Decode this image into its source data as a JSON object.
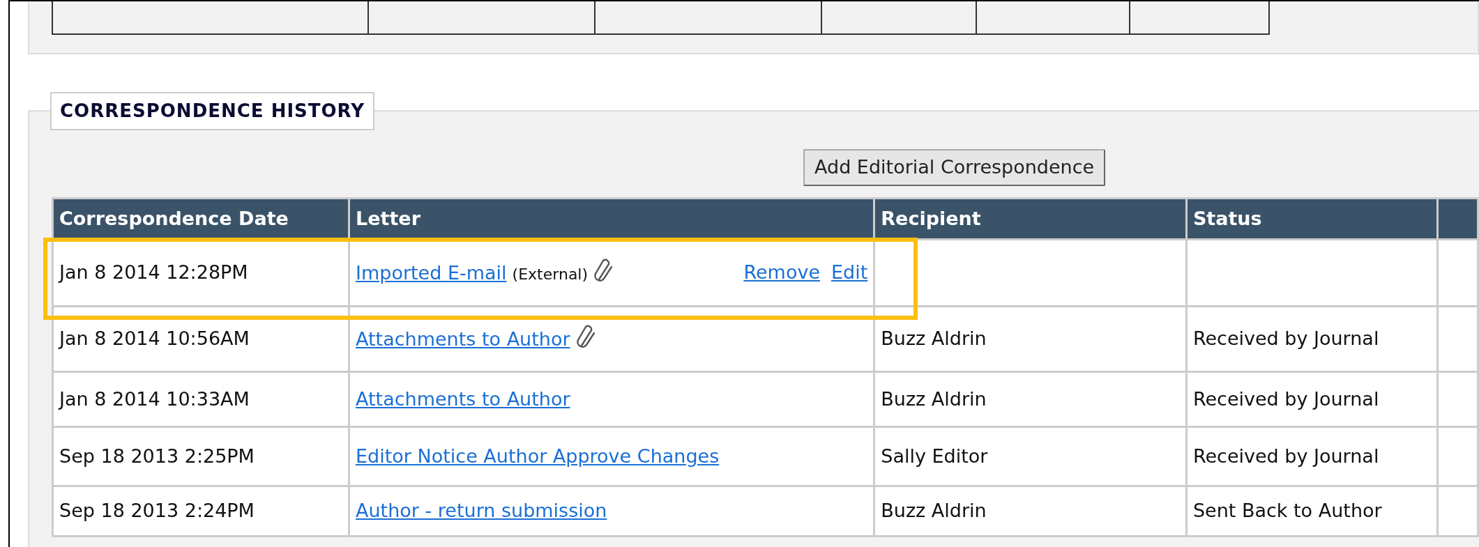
{
  "section": {
    "title": "CORRESPONDENCE HISTORY"
  },
  "add_button": {
    "label": "Add Editorial Correspondence"
  },
  "table": {
    "columns": [
      "Correspondence Date",
      "Letter",
      "Recipient",
      "Status"
    ],
    "rows": [
      {
        "date": "Jan 8 2014 12:28PM",
        "letter": "Imported E-mail",
        "note": "(External)",
        "attachment": true,
        "actions": [
          "Remove",
          "Edit"
        ],
        "recipient": "",
        "status": "",
        "highlighted": true
      },
      {
        "date": "Jan 8 2014 10:56AM",
        "letter": "Attachments to Author",
        "attachment": true,
        "recipient": "Buzz Aldrin",
        "status": "Received by Journal",
        "highlighted": false
      },
      {
        "date": "Jan 8 2014 10:33AM",
        "letter": "Attachments to Author",
        "attachment": false,
        "recipient": "Buzz Aldrin",
        "status": "Received by Journal",
        "highlighted": false
      },
      {
        "date": "Sep 18 2013 2:25PM",
        "letter": "Editor Notice Author Approve Changes",
        "attachment": false,
        "recipient": "Sally Editor",
        "status": "Received by Journal",
        "highlighted": false
      },
      {
        "date": "Sep 18 2013 2:24PM",
        "letter": "Author - return submission",
        "attachment": false,
        "recipient": "Buzz Aldrin",
        "status": "Sent Back to Author",
        "highlighted": false
      }
    ]
  }
}
